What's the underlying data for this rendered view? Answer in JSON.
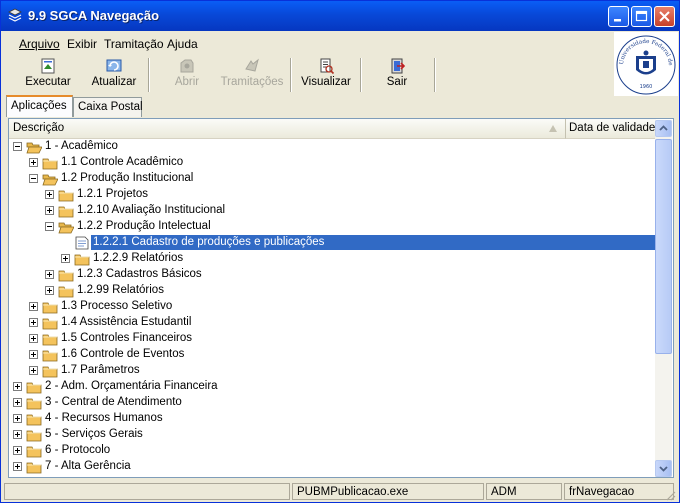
{
  "window": {
    "title": "9.9 SGCA Navegação"
  },
  "menu": {
    "items": [
      "Arquivo",
      "Exibir",
      "Tramitação",
      "Ajuda"
    ]
  },
  "toolbar": {
    "executar": "Executar",
    "atualizar": "Atualizar",
    "abrir": "Abrir",
    "tramitacoes": "Tramitações",
    "visualizar": "Visualizar",
    "sair": "Sair"
  },
  "logo": {
    "text": "Universidade Federal de Santa Maria",
    "year": "1960"
  },
  "tabs": [
    "Aplicações",
    "Caixa Postal"
  ],
  "columns": {
    "descricao": "Descrição",
    "validade": "Data de validade"
  },
  "tree": [
    {
      "label": "1 - Acadêmico",
      "level": 0,
      "state": "expanded",
      "open": true
    },
    {
      "label": "1.1 Controle Acadêmico",
      "level": 1,
      "state": "collapsed",
      "open": false
    },
    {
      "label": "1.2 Produção Institucional",
      "level": 1,
      "state": "expanded",
      "open": true
    },
    {
      "label": "1.2.1 Projetos",
      "level": 2,
      "state": "collapsed",
      "open": false
    },
    {
      "label": "1.2.10 Avaliação Institucional",
      "level": 2,
      "state": "collapsed",
      "open": false
    },
    {
      "label": "1.2.2 Produção Intelectual",
      "level": 2,
      "state": "expanded",
      "open": true
    },
    {
      "label": "1.2.2.1 Cadastro de produções e publicações",
      "level": 3,
      "state": "leaf",
      "open": false,
      "selected": true
    },
    {
      "label": "1.2.2.9 Relatórios",
      "level": 3,
      "state": "collapsed",
      "open": false
    },
    {
      "label": "1.2.3 Cadastros Básicos",
      "level": 2,
      "state": "collapsed",
      "open": false
    },
    {
      "label": "1.2.99 Relatórios",
      "level": 2,
      "state": "collapsed",
      "open": false
    },
    {
      "label": "1.3 Processo Seletivo",
      "level": 1,
      "state": "collapsed",
      "open": false
    },
    {
      "label": "1.4 Assistência Estudantil",
      "level": 1,
      "state": "collapsed",
      "open": false
    },
    {
      "label": "1.5 Controles Financeiros",
      "level": 1,
      "state": "collapsed",
      "open": false
    },
    {
      "label": "1.6 Controle de Eventos",
      "level": 1,
      "state": "collapsed",
      "open": false
    },
    {
      "label": "1.7 Parâmetros",
      "level": 1,
      "state": "collapsed",
      "open": false
    },
    {
      "label": "2 - Adm. Orçamentária Financeira",
      "level": 0,
      "state": "collapsed",
      "open": false
    },
    {
      "label": "3 - Central de Atendimento",
      "level": 0,
      "state": "collapsed",
      "open": false
    },
    {
      "label": "4 - Recursos Humanos",
      "level": 0,
      "state": "collapsed",
      "open": false
    },
    {
      "label": "5 - Serviços Gerais",
      "level": 0,
      "state": "collapsed",
      "open": false
    },
    {
      "label": "6 - Protocolo",
      "level": 0,
      "state": "collapsed",
      "open": false
    },
    {
      "label": "7 - Alta Gerência",
      "level": 0,
      "state": "collapsed",
      "open": false
    }
  ],
  "status": {
    "program": "PUBMPublicacao.exe",
    "user": "ADM",
    "form": "frNavegacao"
  },
  "colors": {
    "selection": "#316ac5",
    "titlebar": "#0848d8",
    "folder": "#f4c35c"
  },
  "icons": [
    "app-icon",
    "minimize-icon",
    "maximize-icon",
    "close-icon",
    "folder-icon",
    "folder-open-icon",
    "document-icon",
    "executar-icon",
    "atualizar-icon",
    "abrir-icon",
    "tramitacoes-icon",
    "visualizar-icon",
    "sair-icon",
    "sort-arrow-icon"
  ]
}
